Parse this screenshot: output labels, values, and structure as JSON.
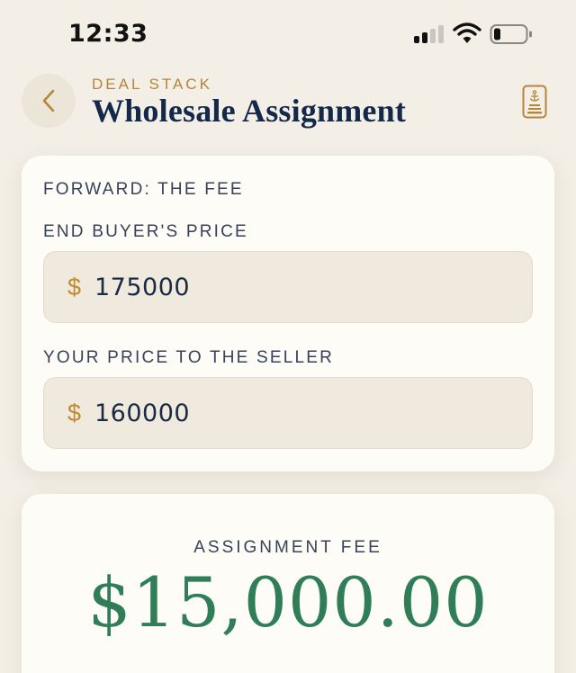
{
  "status_bar": {
    "time": "12:33"
  },
  "header": {
    "eyebrow": "DEAL STACK",
    "title": "Wholesale Assignment"
  },
  "form": {
    "section_title": "FORWARD: THE FEE",
    "fields": [
      {
        "label": "END BUYER'S PRICE",
        "currency_symbol": "$",
        "value": "175000"
      },
      {
        "label": "YOUR PRICE TO THE SELLER",
        "currency_symbol": "$",
        "value": "160000"
      }
    ]
  },
  "result": {
    "label": "ASSIGNMENT FEE",
    "value": "$15,000.00"
  },
  "colors": {
    "background": "#f3efe6",
    "accent_gold": "#b5853a",
    "title_navy": "#14284a",
    "result_green": "#2f7e57"
  },
  "icons": [
    "back-chevron-icon",
    "signal-icon",
    "wifi-icon",
    "battery-icon",
    "logo-icon"
  ]
}
